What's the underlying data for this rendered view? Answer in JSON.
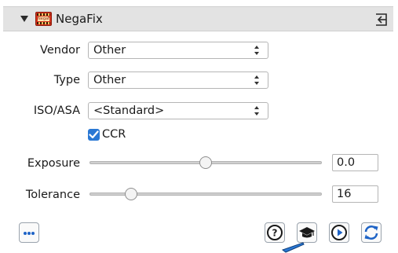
{
  "header": {
    "title": "NegaFix",
    "plugin_icon_text": "NegaFix"
  },
  "fields": {
    "vendor": {
      "label": "Vendor",
      "value": "Other"
    },
    "type": {
      "label": "Type",
      "value": "Other"
    },
    "iso": {
      "label": "ISO/ASA",
      "value": "<Standard>"
    }
  },
  "ccr": {
    "label": "CCR",
    "checked": true
  },
  "sliders": {
    "exposure": {
      "label": "Exposure",
      "value": "0.0",
      "level": 0.5
    },
    "tolerance": {
      "label": "Tolerance",
      "value": "16",
      "level": 0.18
    }
  },
  "colors": {
    "accent": "#2a78d4",
    "header_bg": "#e3e3e3"
  },
  "icons": [
    "collapse-triangle-icon",
    "negafix-plugin-icon",
    "detach-panel-icon",
    "more-options-icon",
    "help-icon",
    "learn-icon",
    "preview-play-icon",
    "refresh-icon"
  ]
}
